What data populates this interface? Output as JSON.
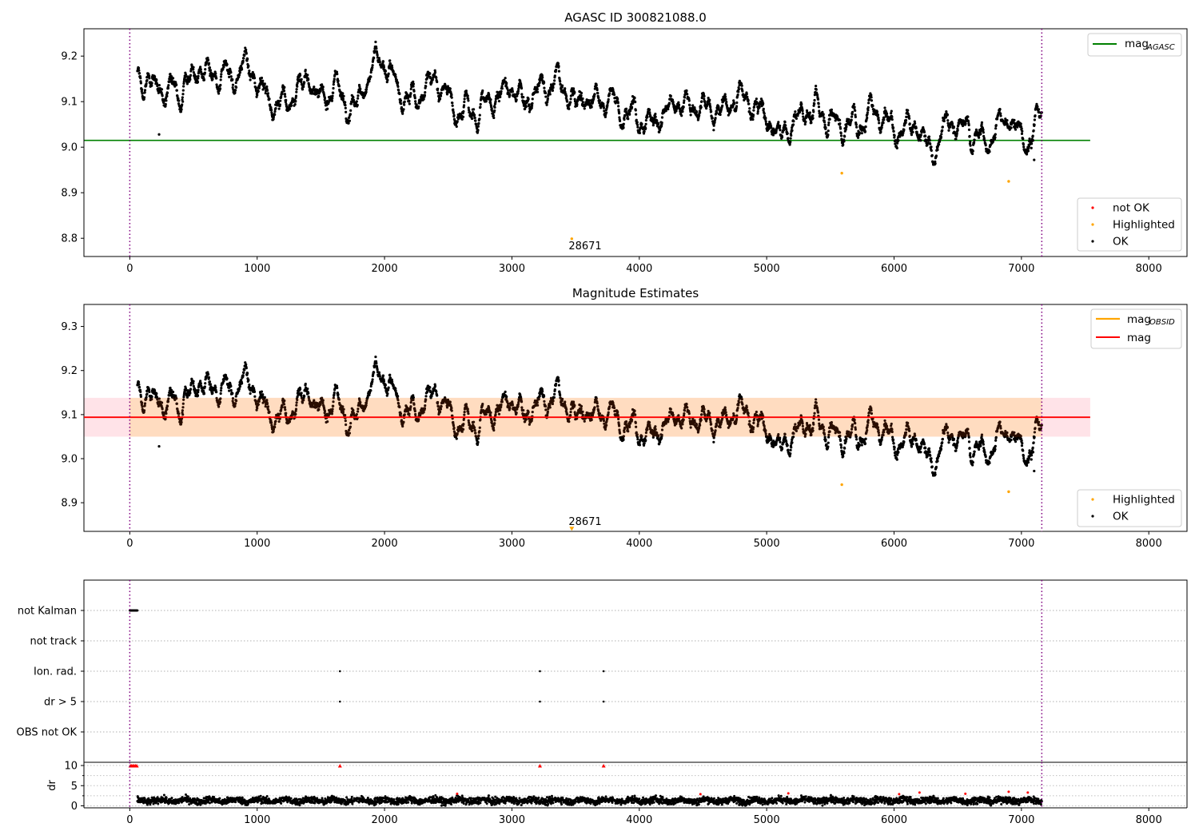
{
  "chart_data": [
    {
      "type": "scatter",
      "title": "AGASC ID 300821088.0",
      "xlabel": "",
      "ylabel": "",
      "xlim": [
        -360,
        8300
      ],
      "ylim": [
        8.76,
        9.26
      ],
      "xticks": [
        0,
        1000,
        2000,
        3000,
        4000,
        5000,
        6000,
        7000,
        8000
      ],
      "yticks": [
        8.8,
        8.9,
        9.0,
        9.1,
        9.2
      ],
      "ytick_labels": [
        "8.8",
        "8.9",
        "9.0",
        "9.1",
        "9.2"
      ],
      "vlines": [
        0,
        7160
      ],
      "hline": {
        "name": "mag",
        "subscript": "AGASC",
        "y": 9.015,
        "x_range": [
          -360,
          7540
        ],
        "color": "#008000"
      },
      "legend_top": [
        {
          "label": "mag",
          "subscript": "AGASC",
          "color": "#008000"
        }
      ],
      "legend_bottom": [
        {
          "label": "not OK",
          "color": "#ff0000"
        },
        {
          "label": "Highlighted",
          "color": "#ffa500"
        },
        {
          "label": "OK",
          "color": "#000000"
        }
      ],
      "ok_series": {
        "name": "OK",
        "color": "#000000",
        "x_range": [
          60,
          7160
        ],
        "profile_x": [
          60,
          300,
          550,
          700,
          900,
          1100,
          1250,
          1400,
          1500,
          1600,
          1750,
          1950,
          2100,
          2300,
          2380,
          2500,
          2700,
          2950,
          3100,
          3350,
          3500,
          3750,
          3900,
          4100,
          4350,
          4600,
          4800,
          5000,
          5100,
          5400,
          5600,
          5800,
          6000,
          6150,
          6300,
          6450,
          6700,
          6900,
          7050,
          7160
        ],
        "profile_y": [
          9.15,
          9.12,
          9.18,
          9.13,
          9.18,
          9.11,
          9.11,
          9.16,
          9.09,
          9.14,
          9.1,
          9.19,
          9.12,
          9.1,
          9.16,
          9.1,
          9.07,
          9.13,
          9.1,
          9.14,
          9.1,
          9.11,
          9.07,
          9.06,
          9.12,
          9.07,
          9.11,
          9.06,
          9.03,
          9.09,
          9.04,
          9.08,
          9.03,
          9.06,
          9.0,
          9.06,
          9.03,
          9.06,
          9.03,
          9.07
        ],
        "outliers": [
          [
            230,
            9.028
          ],
          [
            7100,
            8.972
          ]
        ]
      },
      "highlighted": {
        "name": "Highlighted",
        "color": "#ffa500",
        "points": [
          [
            3470,
            8.799
          ],
          [
            5590,
            8.943
          ],
          [
            6900,
            8.925
          ]
        ]
      },
      "annotation": {
        "text": "28671",
        "x": 3470,
        "y": 8.78
      }
    },
    {
      "type": "scatter",
      "title": "Magnitude Estimates",
      "xlabel": "",
      "ylabel": "",
      "xlim": [
        -360,
        8300
      ],
      "ylim": [
        8.835,
        9.35
      ],
      "xticks": [
        0,
        1000,
        2000,
        3000,
        4000,
        5000,
        6000,
        7000,
        8000
      ],
      "yticks": [
        8.9,
        9.0,
        9.1,
        9.2,
        9.3
      ],
      "ytick_labels": [
        "8.9",
        "9.0",
        "9.1",
        "9.2",
        "9.3"
      ],
      "vlines": [
        0,
        7160
      ],
      "hline": {
        "name": "mag",
        "y": 9.094,
        "x_range": [
          -360,
          7540
        ],
        "color": "#ff0000"
      },
      "band": {
        "y_range": [
          9.05,
          9.138
        ],
        "x_range": [
          -360,
          7540
        ],
        "color": "#ffc0cb"
      },
      "band_inner": {
        "y_range": [
          9.05,
          9.138
        ],
        "x_range": [
          0,
          7160
        ],
        "color": "#ffdab9"
      },
      "legend_top": [
        {
          "label": "mag",
          "subscript": "OBSID",
          "color": "#ffa500"
        },
        {
          "label": "mag",
          "color": "#ff0000"
        }
      ],
      "legend_bottom": [
        {
          "label": "Highlighted",
          "color": "#ffa500"
        },
        {
          "label": "OK",
          "color": "#000000"
        }
      ],
      "ok_series": {
        "name": "OK",
        "color": "#000000",
        "band_tint": "#2a0e00",
        "same_as_panel": 0
      },
      "highlighted": {
        "name": "Highlighted",
        "color": "#ffa500",
        "points": [
          [
            5590,
            8.941
          ],
          [
            6900,
            8.925
          ]
        ]
      },
      "marker_triangle": {
        "x": 3470,
        "y": 8.84,
        "color": "#ffa500"
      },
      "annotation": {
        "text": "28671",
        "x": 3470,
        "y": 8.86
      }
    },
    {
      "type": "scatter",
      "title": "",
      "categories": [
        "not Kalman",
        "not track",
        "Ion. rad.",
        "dr > 5",
        "OBS not OK"
      ],
      "xlim": [
        -360,
        8300
      ],
      "vlines": [
        0,
        7160
      ],
      "category_points": {
        "not Kalman": {
          "x_range": [
            0,
            60
          ],
          "dense": true
        },
        "not track": [],
        "Ion. rad.": [
          1650,
          3220,
          3720
        ],
        "dr > 5": [
          1650,
          3220,
          3720
        ],
        "OBS not OK": []
      }
    },
    {
      "type": "scatter",
      "title": "",
      "xlabel": "",
      "ylabel": "dr",
      "xlim": [
        -360,
        8300
      ],
      "ylim": [
        -0.5,
        10.8
      ],
      "xticks": [
        0,
        1000,
        2000,
        3000,
        4000,
        5000,
        6000,
        7000,
        8000
      ],
      "yticks": [
        0,
        5,
        10
      ],
      "ytick_labels": [
        "0",
        "5",
        "10"
      ],
      "vlines": [
        0,
        7160
      ],
      "dr_series": {
        "name": "OK",
        "color": "#000000",
        "x_range": [
          60,
          7160
        ],
        "mean": 1.3,
        "spread": 0.9
      },
      "red_markers": {
        "color": "#ff0000",
        "capped_at_10": [
          [
            5,
            9.9
          ],
          [
            15,
            9.9
          ],
          [
            25,
            9.9
          ],
          [
            35,
            9.9
          ],
          [
            45,
            9.9
          ],
          [
            55,
            9.9
          ],
          [
            1650,
            9.9
          ],
          [
            3220,
            9.9
          ],
          [
            3720,
            9.9
          ]
        ],
        "points": [
          [
            2570,
            3.0
          ],
          [
            4480,
            2.9
          ],
          [
            5170,
            3.1
          ],
          [
            6040,
            2.9
          ],
          [
            6200,
            3.3
          ],
          [
            6560,
            3.0
          ],
          [
            6900,
            3.5
          ],
          [
            7050,
            3.3
          ]
        ]
      }
    }
  ]
}
